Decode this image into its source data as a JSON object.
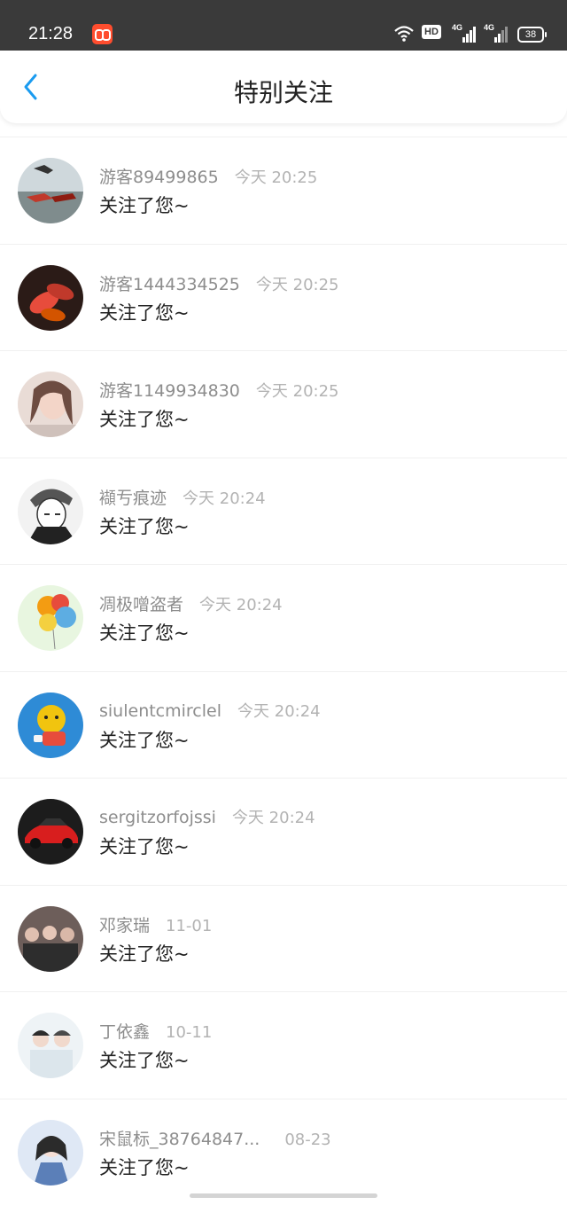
{
  "status_bar": {
    "time": "21:28",
    "hd_label": "HD",
    "signal1_label": "4G",
    "signal2_label": "4G",
    "battery": "38"
  },
  "header": {
    "back_icon": "chevron-left-icon",
    "title": "特别关注"
  },
  "colors": {
    "accent": "#1a9bf0",
    "status_bar_bg": "#3a3a3a",
    "name_text": "#8d8d8d",
    "time_text": "#b3b3b3"
  },
  "items": [
    {
      "name": "游客89499865",
      "time": "今天 20:25",
      "message": "关注了您~"
    },
    {
      "name": "游客1444334525",
      "time": "今天 20:25",
      "message": "关注了您~"
    },
    {
      "name": "游客1149934830",
      "time": "今天 20:25",
      "message": "关注了您~"
    },
    {
      "name": "襭亐痕迹",
      "time": "今天 20:24",
      "message": "关注了您~"
    },
    {
      "name": "凋极噌盗者",
      "time": "今天 20:24",
      "message": "关注了您~"
    },
    {
      "name": "siulentcmirclel",
      "time": "今天 20:24",
      "message": "关注了您~"
    },
    {
      "name": "sergitzorfojssi",
      "time": "今天 20:24",
      "message": "关注了您~"
    },
    {
      "name": "邓家瑞",
      "time": "11-01",
      "message": "关注了您~"
    },
    {
      "name": "丁依鑫",
      "time": "10-11",
      "message": "关注了您~"
    },
    {
      "name": "宋鼠标_38764847...",
      "time": "08-23",
      "message": "关注了您~"
    }
  ]
}
